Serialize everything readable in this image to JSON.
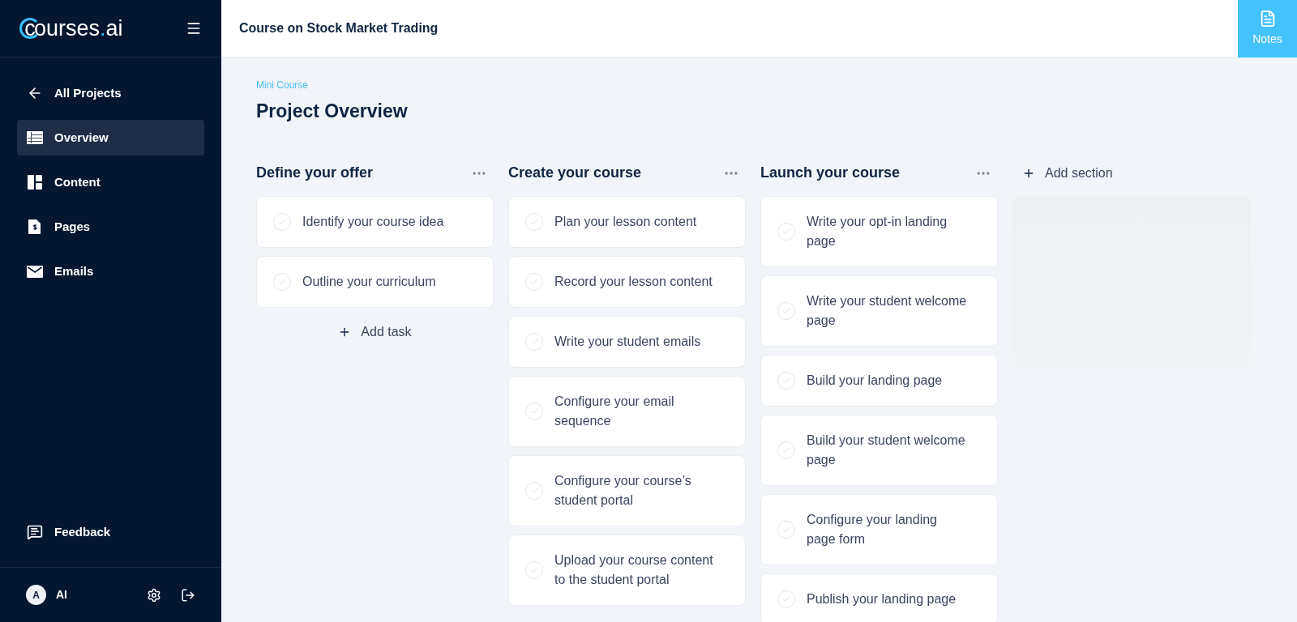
{
  "sidebar": {
    "logo": {
      "prefix": "c",
      "name": "ourses",
      "dot": ".",
      "suffix": "ai"
    },
    "back_link": "All Projects",
    "items": [
      {
        "label": "Overview",
        "kind": "table",
        "selected": true
      },
      {
        "label": "Content",
        "kind": "layout",
        "selected": false
      },
      {
        "label": "Pages",
        "kind": "page",
        "selected": false
      },
      {
        "label": "Emails",
        "kind": "mail",
        "selected": false
      }
    ],
    "feedback": "Feedback",
    "user": {
      "initial": "A",
      "name": "AI"
    }
  },
  "header": {
    "title": "Course on Stock Market Trading",
    "notes_button": "Notes"
  },
  "page": {
    "eyebrow": "Mini Course",
    "title": "Project Overview"
  },
  "sections": [
    {
      "title": "Define your offer",
      "add_task": "Add task",
      "tasks": [
        {
          "label": "Identify your course idea",
          "checked": false
        },
        {
          "label": "Outline your curriculum",
          "checked": false
        }
      ]
    },
    {
      "title": "Create your course",
      "tasks": [
        {
          "label": "Plan your lesson content",
          "checked": false
        },
        {
          "label": "Record your lesson content",
          "checked": false
        },
        {
          "label": "Write your student emails",
          "checked": false
        },
        {
          "label": "Configure your email sequence",
          "checked": false
        },
        {
          "label": "Configure your course’s student portal",
          "checked": false
        },
        {
          "label": "Upload your course content to the student portal",
          "checked": false
        }
      ]
    },
    {
      "title": "Launch your course",
      "tasks": [
        {
          "label": "Write your opt-in landing page",
          "checked": false
        },
        {
          "label": "Write your student welcome page",
          "checked": false
        },
        {
          "label": "Build your landing page",
          "checked": false
        },
        {
          "label": "Build your student welcome page",
          "checked": false
        },
        {
          "label": "Configure your landing page form",
          "checked": false
        },
        {
          "label": "Publish your landing page",
          "checked": false
        }
      ]
    }
  ],
  "add_section": "Add section"
}
